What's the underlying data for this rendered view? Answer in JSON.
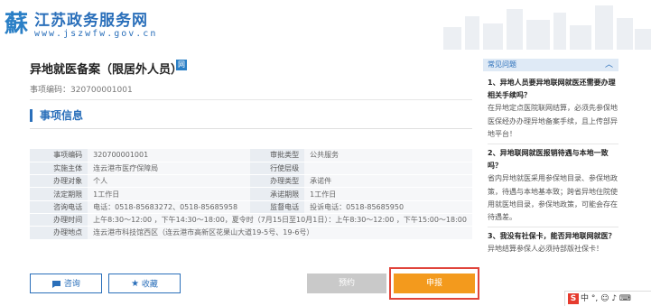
{
  "header": {
    "logo_char": "蘇",
    "site_name": "江苏政务服务网",
    "site_url": "www.jszwfw.gov.cn"
  },
  "page": {
    "title": "异地就医备案（限居外人员）",
    "badge": "网",
    "item_code_line": "事项编码：320700001001",
    "section_title": "事项信息"
  },
  "info_rows": [
    {
      "k1": "事项编码",
      "v1": "320700001001",
      "k2": "审批类型",
      "v2": "公共服务"
    },
    {
      "k1": "实施主体",
      "v1": "连云港市医疗保障局",
      "k2": "行使层级",
      "v2": ""
    },
    {
      "k1": "办理对象",
      "v1": "个人",
      "k2": "办理类型",
      "v2": "承诺件"
    },
    {
      "k1": "法定期限",
      "v1": "1工作日",
      "k2": "承诺期限",
      "v2": "1工作日"
    },
    {
      "k1": "咨询电话",
      "v1": "电话：0518-85683272、0518-85685958",
      "k2": "监督电话",
      "v2": "投诉电话：0518-85685950"
    }
  ],
  "info_wide_rows": [
    {
      "k": "办理时间",
      "v": "上午8:30～12:00 ，下午14:30～18:00，夏令时（7月15日至10月1日）：上午8:30～12:00 ，下午15:00～18:00"
    },
    {
      "k": "办理地点",
      "v": "连云港市科技馆西区（连云港市高新区花果山大道19-5号、19-6号）"
    }
  ],
  "buttons": {
    "consult": "咨询",
    "favorite": "收藏",
    "book": "预约",
    "apply": "申报"
  },
  "faq": {
    "header": "常见问题",
    "items": [
      {
        "q": "1、异地人员要异地联网就医还需要办理相关手续吗？",
        "a": "在异地定点医院联网结算，必须先参保地医保经办办理异地备案手续，且上传部异地平台！"
      },
      {
        "q": "2、异地联网就医报销待遇与本地一致吗？",
        "a": "省内异地就医采用参保地目录、参保地政策，待遇与本地基本致；跨省异地住院使用就医地目录，参保地政策，可能会存在待遇差。"
      },
      {
        "q": "3、我没有社保卡，能否异地联网就医？",
        "a": "异地结算参保人必须持部版社保卡！"
      }
    ]
  },
  "ime": {
    "logo": "S",
    "text": "中 °, ☺ ♪ ⌨"
  },
  "colors": {
    "brand": "#2a6fba",
    "apply": "#f39a1d",
    "highlight": "#e0443b"
  }
}
